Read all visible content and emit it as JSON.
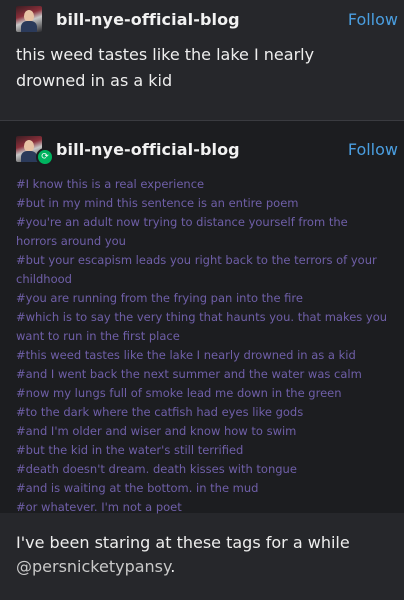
{
  "post1": {
    "username": "bill-nye-official-blog",
    "follow_label": "Follow",
    "text": "this weed tastes like the lake I nearly drowned in as a kid"
  },
  "reblog": {
    "username": "bill-nye-official-blog",
    "follow_label": "Follow",
    "tags": [
      "#I know this is a real experience",
      "#but in my mind this sentence is an entire poem",
      "#you're an adult now trying to distance yourself from the horrors around you",
      "#but your escapism leads you right back to the terrors of your childhood",
      "#you are running from the frying pan into the fire",
      "#which is to say the very thing that haunts you. that makes you want to run in the first place",
      "#this weed tastes like the lake I nearly drowned in as a kid",
      "#and I went back the next summer and the water was calm",
      "#now my lungs full of smoke lead me down in the green",
      "#to the dark where the catfish had eyes like gods",
      "#and I'm older and wiser and know how to swim",
      "#but the kid in the water's still terrified",
      "#death doesn't dream. death kisses with tongue",
      "#and is waiting at the bottom. in the mud",
      "#or whatever. I'm not a poet"
    ]
  },
  "footer": {
    "text": "I've been staring at these tags for a while",
    "mention": "@persnicketypansy",
    "suffix": "."
  },
  "icons": {
    "reblog_badge": "reblog-icon"
  },
  "colors": {
    "background": "#26272b",
    "reblog_background": "#1c1d20",
    "follow": "#4a9ee0",
    "tags": "#6f5fa8",
    "reblog_badge": "#00b35f"
  }
}
